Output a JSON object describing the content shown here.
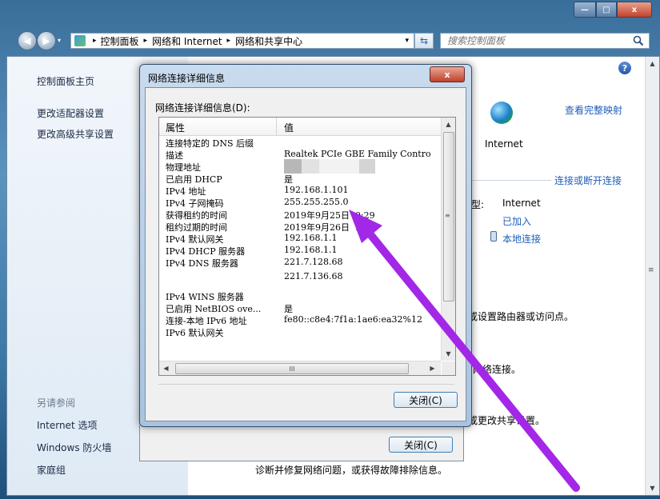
{
  "window": {
    "caption_min": "—",
    "caption_max": "□",
    "caption_close": "x"
  },
  "nav": {
    "back_glyph": "◀",
    "forward_glyph": "▶",
    "address_sep": "▸",
    "address_parts": [
      "控制面板",
      "网络和 Internet",
      "网络和共享中心"
    ],
    "dropdown_glyph": "▾",
    "refresh_glyph": "⇆",
    "search_placeholder": "搜索控制面板",
    "search_icon": "magnifier-icon"
  },
  "left_pane": {
    "home": "控制面板主页",
    "links": [
      "更改适配器设置",
      "更改高级共享设置"
    ],
    "see_also_heading": "另请参阅",
    "see_also": [
      "Internet 选项",
      "Windows 防火墙",
      "家庭组"
    ]
  },
  "right_pane": {
    "help": "?",
    "view_full_map": "查看完整映射",
    "internet_label": "Internet",
    "connect_disconnect": "连接或断开连接",
    "access_type_suffix": "型:",
    "access_value": "Internet",
    "joined": "已加入",
    "local_connection": "本地连接",
    "text_router": "或设置路由器或访问点。",
    "text_network": "网络连接。",
    "text_sharing": "或更改共享设置。",
    "text_diagnose": "诊断并修复网络问题，或获得故障排除信息。"
  },
  "back_dialog": {
    "close_button": "关闭(C)"
  },
  "details_dialog": {
    "title": "网络连接详细信息",
    "close_x": "x",
    "label": "网络连接详细信息(D):",
    "col_property": "属性",
    "col_value": "值",
    "rows": [
      {
        "p": "连接特定的 DNS 后缀",
        "v": ""
      },
      {
        "p": "描述",
        "v": "Realtek PCIe GBE Family Contro"
      },
      {
        "p": "物理地址",
        "v": ""
      },
      {
        "p": "已启用 DHCP",
        "v": "是"
      },
      {
        "p": "IPv4 地址",
        "v": "192.168.1.101"
      },
      {
        "p": "IPv4 子网掩码",
        "v": "255.255.255.0"
      },
      {
        "p": "获得租约的时间",
        "v": "2019年9月25日 ‌ 9:29"
      },
      {
        "p": "租约过期的时间",
        "v": "2019年9月26日 ‌ :22"
      },
      {
        "p": "IPv4 默认网关",
        "v": "192.168.1.1"
      },
      {
        "p": "IPv4 DHCP 服务器",
        "v": "192.168.1.1"
      },
      {
        "p": "IPv4 DNS 服务器",
        "v": "221.7.128.68"
      },
      {
        "p": "",
        "v": "221.7.136.68"
      },
      {
        "p": "IPv4 WINS 服务器",
        "v": ""
      },
      {
        "p": "已启用 NetBIOS ove...",
        "v": "是"
      },
      {
        "p": "连接-本地 IPv6 地址",
        "v": "fe80::c8e4:7f1a:1ae6:ea32%12"
      },
      {
        "p": "IPv6 默认网关",
        "v": ""
      }
    ],
    "hscroll_grip": "III",
    "close_button": "关闭(C)"
  },
  "colors": {
    "annotation_arrow": "#a327e6",
    "link_blue": "#1f5fb7"
  }
}
